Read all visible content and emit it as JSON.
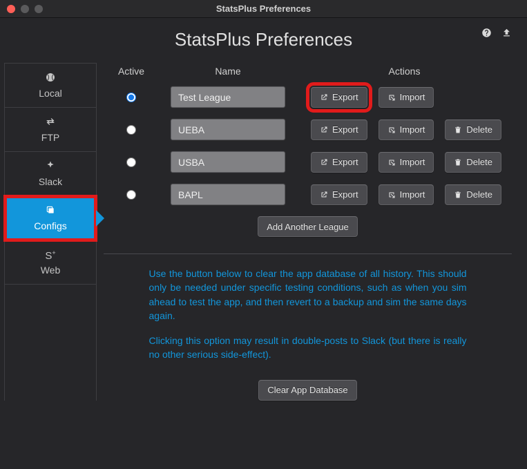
{
  "titlebar": {
    "title": "StatsPlus Preferences"
  },
  "header": {
    "title": "StatsPlus Preferences",
    "help_icon": "help-icon",
    "upload_icon": "upload-icon"
  },
  "sidebar": {
    "items": [
      {
        "id": "local",
        "label": "Local",
        "icon": "baseball-icon"
      },
      {
        "id": "ftp",
        "label": "FTP",
        "icon": "transfer-icon"
      },
      {
        "id": "slack",
        "label": "Slack",
        "icon": "slack-icon"
      },
      {
        "id": "configs",
        "label": "Configs",
        "icon": "copy-icon",
        "active": true
      },
      {
        "id": "splusweb",
        "label": "Web",
        "icon": "splus-icon",
        "prefix": "S",
        "sup": "+"
      }
    ]
  },
  "table": {
    "headers": {
      "active": "Active",
      "name": "Name",
      "actions": "Actions"
    },
    "rows": [
      {
        "active": true,
        "name": "Test League",
        "export": "Export",
        "import": "Import",
        "can_delete": false
      },
      {
        "active": false,
        "name": "UEBA",
        "export": "Export",
        "import": "Import",
        "delete": "Delete",
        "can_delete": true
      },
      {
        "active": false,
        "name": "USBA",
        "export": "Export",
        "import": "Import",
        "delete": "Delete",
        "can_delete": true
      },
      {
        "active": false,
        "name": "BAPL",
        "export": "Export",
        "import": "Import",
        "delete": "Delete",
        "can_delete": true
      }
    ]
  },
  "buttons": {
    "add_another": "Add Another League",
    "clear_db": "Clear App Database"
  },
  "info": {
    "p1": "Use the button below to clear the app database of all history. This should only be needed under specific testing conditions, such as when you sim ahead to test the app, and then revert to a backup and sim the same days again.",
    "p2": "Clicking this option may result in double-posts to Slack (but there is really no other serious side-effect)."
  },
  "highlight": {
    "export_row_index": 0,
    "sidebar_highlight_id": "configs"
  }
}
